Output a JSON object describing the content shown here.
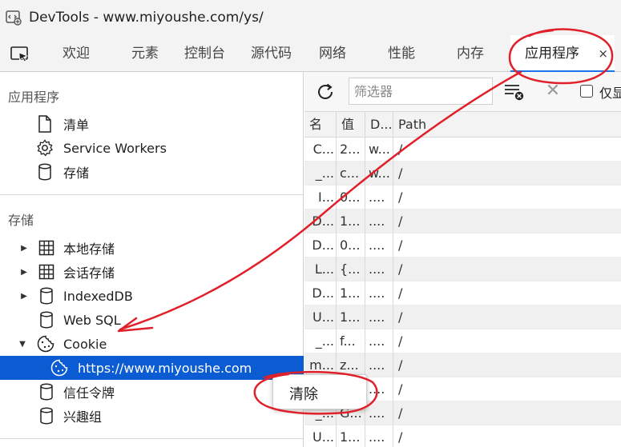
{
  "window": {
    "title": "DevTools - www.miyoushe.com/ys/"
  },
  "tabs": [
    {
      "label": "欢迎"
    },
    {
      "label": "元素"
    },
    {
      "label": "控制台"
    },
    {
      "label": "源代码"
    },
    {
      "label": "网络"
    },
    {
      "label": "性能"
    },
    {
      "label": "内存"
    },
    {
      "label": "应用程序",
      "active": true
    }
  ],
  "tab_close": "×",
  "sidebar": {
    "app_section": "应用程序",
    "app_items": [
      {
        "label": "清单",
        "icon": "document-icon"
      },
      {
        "label": "Service Workers",
        "icon": "gear-icon"
      },
      {
        "label": "存储",
        "icon": "database-icon"
      }
    ],
    "storage_section": "存储",
    "storage_items": [
      {
        "label": "本地存储",
        "icon": "grid-icon",
        "expander": "collapsed"
      },
      {
        "label": "会话存储",
        "icon": "grid-icon",
        "expander": "collapsed"
      },
      {
        "label": "IndexedDB",
        "icon": "database-icon",
        "expander": "collapsed"
      },
      {
        "label": "Web SQL",
        "icon": "database-icon"
      },
      {
        "label": "Cookie",
        "icon": "cookie-icon",
        "expander": "expanded"
      },
      {
        "label": "https://www.miyoushe.com",
        "icon": "cookie-icon",
        "selected": true
      },
      {
        "label": "信任令牌",
        "icon": "database-icon"
      },
      {
        "label": "兴趣组",
        "icon": "database-icon"
      }
    ]
  },
  "toolbar": {
    "filter_placeholder": "筛选器",
    "only_label": "仅显"
  },
  "table": {
    "headers": [
      "名",
      "值",
      "D...",
      "Path"
    ],
    "rows": [
      [
        "C...",
        "2...",
        "w...",
        "/"
      ],
      [
        "_...",
        "c...",
        "w...",
        "/"
      ],
      [
        "I...",
        "0...",
        "....",
        "/"
      ],
      [
        "D...",
        "1...",
        "....",
        "/"
      ],
      [
        "D...",
        "0...",
        "....",
        "/"
      ],
      [
        "L...",
        "{...",
        "....",
        "/"
      ],
      [
        "D...",
        "1...",
        "....",
        "/"
      ],
      [
        "U...",
        "1...",
        "....",
        "/"
      ],
      [
        "_...",
        "f...",
        "....",
        "/"
      ],
      [
        "m...",
        "z...",
        "....",
        "/"
      ],
      [
        "",
        "",
        "....",
        "/"
      ],
      [
        "_...",
        "G...",
        "....",
        "/"
      ],
      [
        "U...",
        "1...",
        "....",
        "/"
      ]
    ]
  },
  "context_menu": {
    "clear_label": "清除"
  },
  "colors": {
    "accent": "#1a73e8",
    "selection": "#0b5bd3",
    "annotation": "#e0202a"
  }
}
